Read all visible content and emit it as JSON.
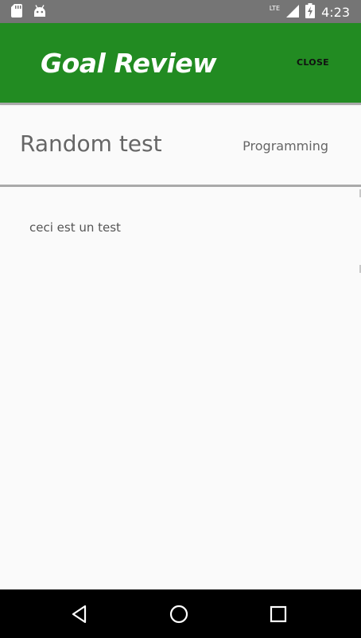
{
  "status_bar": {
    "time": "4:23",
    "network": "LTE",
    "icons": [
      "sd-card-icon",
      "android-icon",
      "lte-signal-icon",
      "battery-charging-icon"
    ]
  },
  "app_bar": {
    "title": "Goal Review",
    "close_label": "CLOSE",
    "color": "#228b22"
  },
  "goal": {
    "title": "Random test",
    "category": "Programming",
    "description": "ceci est un test"
  },
  "nav_bar": {
    "icons": [
      "back-icon",
      "home-icon",
      "recents-icon"
    ]
  }
}
